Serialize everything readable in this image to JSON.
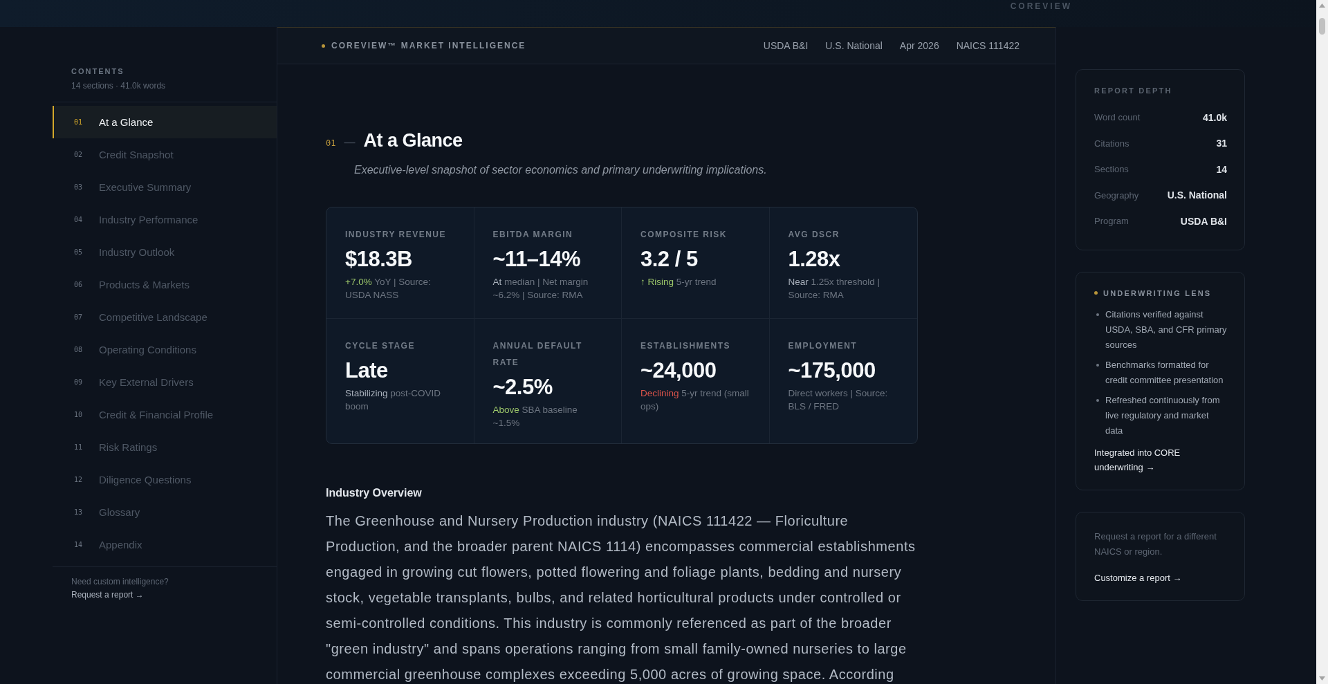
{
  "top_bar": {
    "brand": "COREVIEW"
  },
  "sidebar": {
    "heading": "CONTENTS",
    "summary": "14 sections · 41.0k words",
    "items": [
      {
        "number": "01",
        "label": "At a Glance",
        "selected": true
      },
      {
        "number": "02",
        "label": "Credit Snapshot",
        "selected": false
      },
      {
        "number": "03",
        "label": "Executive Summary",
        "selected": false
      },
      {
        "number": "04",
        "label": "Industry Performance",
        "selected": false
      },
      {
        "number": "05",
        "label": "Industry Outlook",
        "selected": false
      },
      {
        "number": "06",
        "label": "Products & Markets",
        "selected": false
      },
      {
        "number": "07",
        "label": "Competitive Landscape",
        "selected": false
      },
      {
        "number": "08",
        "label": "Operating Conditions",
        "selected": false
      },
      {
        "number": "09",
        "label": "Key External Drivers",
        "selected": false
      },
      {
        "number": "10",
        "label": "Credit & Financial Profile",
        "selected": false
      },
      {
        "number": "11",
        "label": "Risk Ratings",
        "selected": false
      },
      {
        "number": "12",
        "label": "Diligence Questions",
        "selected": false
      },
      {
        "number": "13",
        "label": "Glossary",
        "selected": false
      },
      {
        "number": "14",
        "label": "Appendix",
        "selected": false
      }
    ],
    "footer_note": "Need custom intelligence?",
    "footer_link": "Request a report →"
  },
  "header": {
    "brand": "COREVIEW™ MARKET INTELLIGENCE",
    "meta": [
      "USDA B&I",
      "U.S. National",
      "Apr 2026",
      "NAICS 111422"
    ]
  },
  "section": {
    "number": "01",
    "dash": "—",
    "title": "At a Glance",
    "subtitle": "Executive-level snapshot of sector economics and primary underwriting implications."
  },
  "metrics": [
    {
      "label": "INDUSTRY REVENUE",
      "value": "$18.3B",
      "note": [
        {
          "text": "+7.0%",
          "color": "#9cc66a"
        },
        {
          "text": "YoY | Source: USDA NASS"
        }
      ]
    },
    {
      "label": "EBITDA MARGIN",
      "value": "~11–14%",
      "note": [
        {
          "text": "At",
          "color": "#a7afba"
        },
        {
          "text": "median | Net margin ~6.2% | Source: RMA"
        }
      ]
    },
    {
      "label": "COMPOSITE RISK",
      "value": "3.2 / 5",
      "note": [
        {
          "text": "↑ Rising",
          "color": "#9cc66a"
        },
        {
          "text": "5-yr trend"
        }
      ]
    },
    {
      "label": "AVG DSCR",
      "value": "1.28x",
      "note": [
        {
          "text": "Near",
          "color": "#a7afba"
        },
        {
          "text": "1.25x threshold | Source: RMA"
        }
      ]
    },
    {
      "label": "CYCLE STAGE",
      "value": "Late",
      "note": [
        {
          "text": "Stabilizing",
          "color": "#a7afba"
        },
        {
          "text": "post-COVID boom"
        }
      ]
    },
    {
      "label": "ANNUAL DEFAULT RATE",
      "value": "~2.5%",
      "note": [
        {
          "text": "Above",
          "color": "#9cc66a"
        },
        {
          "text": "SBA baseline ~1.5%"
        }
      ]
    },
    {
      "label": "ESTABLISHMENTS",
      "value": "~24,000",
      "note": [
        {
          "text": "Declining",
          "color": "#d9534a"
        },
        {
          "text": "5-yr trend (small ops)"
        }
      ]
    },
    {
      "label": "EMPLOYMENT",
      "value": "~175,000",
      "note": [
        {
          "text": "Direct workers | Source: BLS / FRED"
        }
      ]
    }
  ],
  "overview": {
    "heading": "Industry Overview",
    "paragraph": "The Greenhouse and Nursery Production industry (NAICS 111422 — Floriculture Production, and the broader parent NAICS 1114) encompasses commercial establishments engaged in growing cut flowers, potted flowering and foliage plants, bedding and nursery stock, vegetable transplants, bulbs, and related horticultural products under controlled or semi-controlled conditions. This industry is commonly referenced as part of the broader \"green industry\" and spans operations ranging from small family-owned nurseries to large commercial greenhouse complexes exceeding 5,000 acres of growing space. According"
  },
  "report_depth": {
    "heading": "REPORT DEPTH",
    "rows": [
      {
        "label": "Word count",
        "value": "41.0k"
      },
      {
        "label": "Citations",
        "value": "31"
      },
      {
        "label": "Sections",
        "value": "14"
      },
      {
        "label": "Geography",
        "value": "U.S. National"
      },
      {
        "label": "Program",
        "value": "USDA B&I"
      }
    ]
  },
  "underwriting_lens": {
    "heading": "UNDERWRITING LENS",
    "bullets": [
      "Citations verified against USDA, SBA, and CFR primary sources",
      "Benchmarks formatted for credit committee presentation",
      "Refreshed continuously from live regulatory and market data"
    ],
    "link": "Integrated into CORE underwriting →"
  },
  "request_card": {
    "text": "Request a report for a different NAICS or region.",
    "link": "Customize a report →"
  }
}
